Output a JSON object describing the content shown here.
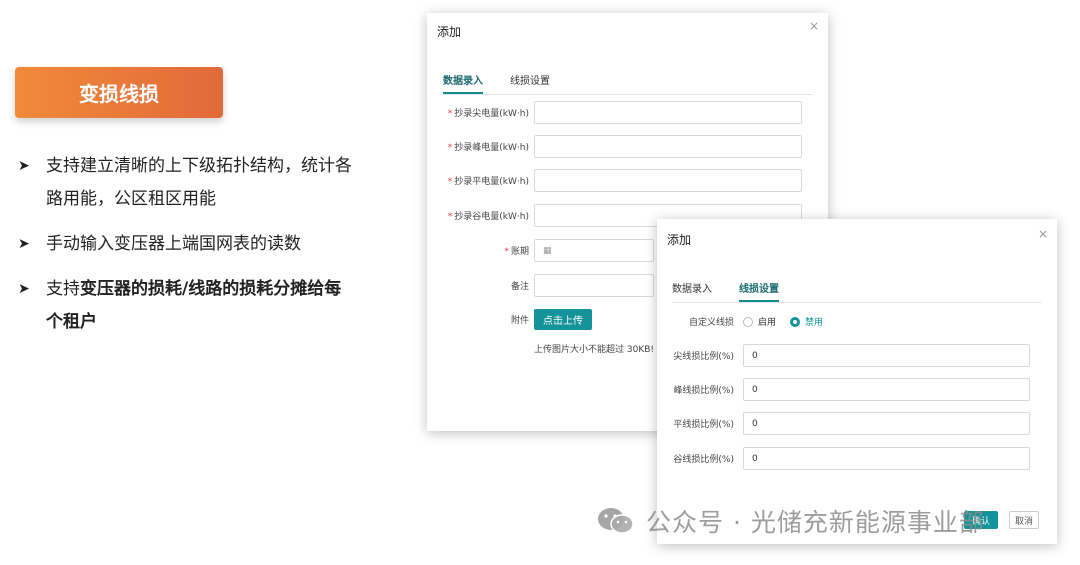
{
  "left": {
    "badge": "变损线损",
    "bullets": [
      {
        "normal": "支持建立清晰的上下级拓扑结构，统计各路用能，公区租区用能",
        "bold": ""
      },
      {
        "normal": "手动输入变压器上端国网表的读数",
        "bold": ""
      },
      {
        "prefix": "支持",
        "bold": "变压器的损耗/线路的损耗分摊给每个租户"
      }
    ]
  },
  "dialog1": {
    "title": "添加",
    "close": "×",
    "tabs": [
      "数据录入",
      "线损设置"
    ],
    "active_tab": 0,
    "fields": [
      {
        "label": "抄录尖电量(kW·h)",
        "required": true,
        "value": ""
      },
      {
        "label": "抄录峰电量(kW·h)",
        "required": true,
        "value": ""
      },
      {
        "label": "抄录平电量(kW·h)",
        "required": true,
        "value": ""
      },
      {
        "label": "抄录谷电量(kW·h)",
        "required": true,
        "value": ""
      },
      {
        "label": "账期",
        "required": true,
        "value": ""
      },
      {
        "label": "备注",
        "required": false,
        "value": ""
      }
    ],
    "attachment_label": "附件",
    "upload_button": "点击上传",
    "upload_hint": "上传图片大小不能超过 30KB!"
  },
  "dialog2": {
    "title": "添加",
    "close": "×",
    "tabs": [
      "数据录入",
      "线损设置"
    ],
    "active_tab": 1,
    "custom_label": "自定义线损",
    "options": [
      {
        "label": "启用",
        "selected": false
      },
      {
        "label": "禁用",
        "selected": true
      }
    ],
    "fields": [
      {
        "label": "尖线损比例(%)",
        "value": "0"
      },
      {
        "label": "峰线损比例(%)",
        "value": "0"
      },
      {
        "label": "平线损比例(%)",
        "value": "0"
      },
      {
        "label": "谷线损比例(%)",
        "value": "0"
      }
    ],
    "confirm": "确认",
    "cancel": "取消"
  },
  "watermark": "公众号 · 光储充新能源事业部",
  "colors": {
    "accent": "#14939a",
    "badge_from": "#f18a3a",
    "badge_to": "#e2693a"
  }
}
